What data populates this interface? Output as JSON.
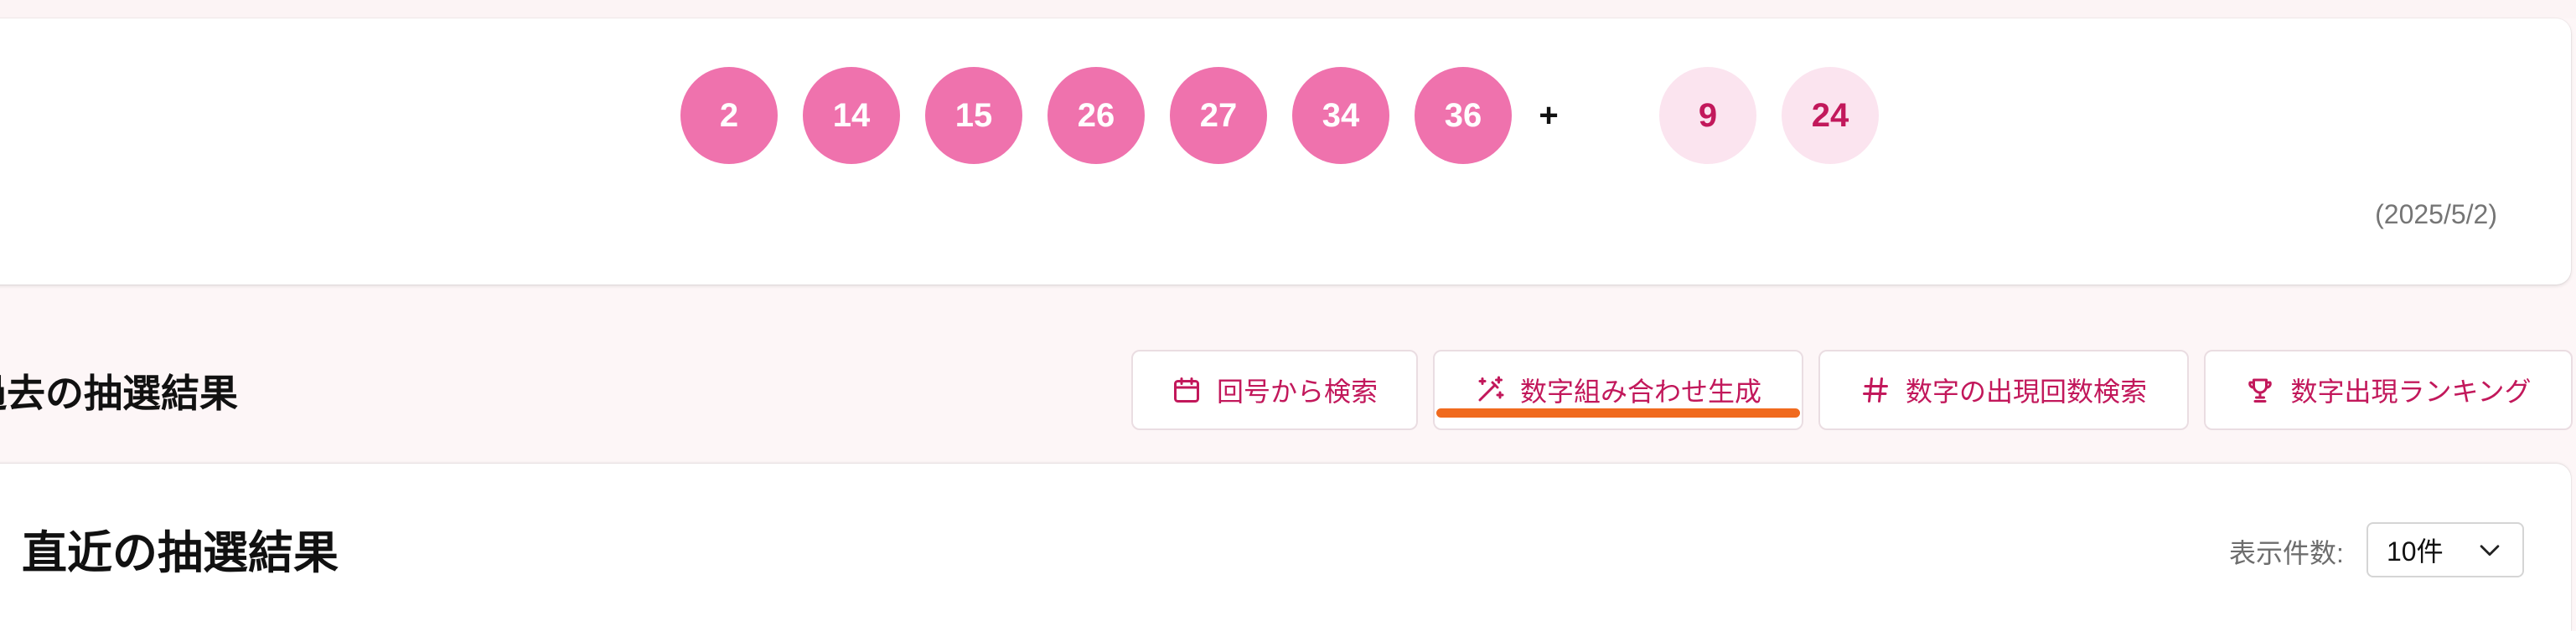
{
  "latest_draw": {
    "main_numbers": [
      "2",
      "14",
      "15",
      "26",
      "27",
      "34",
      "36"
    ],
    "plus_sign": "+",
    "bonus_numbers": [
      "9",
      "24"
    ],
    "date": "(2025/5/2)",
    "colors": {
      "main_ball": "#ef72ad",
      "bonus_ball": "#fbe4ef",
      "bonus_text": "#c2185b"
    }
  },
  "past_results": {
    "section_title": "過去の抽選結果",
    "nav_buttons": [
      {
        "label": "回号から検索",
        "icon": "calendar-icon"
      },
      {
        "label": "数字組み合わせ生成",
        "icon": "magic-wand-icon",
        "active": true
      },
      {
        "label": "数字の出現回数検索",
        "icon": "hash-icon"
      },
      {
        "label": "数字出現ランキング",
        "icon": "trophy-icon"
      }
    ],
    "accent_color": "#c2185b",
    "active_underline_color": "#f06a1e"
  },
  "recent": {
    "title": "直近の抽選結果",
    "count_label": "表示件数:",
    "count_value": "10件"
  }
}
